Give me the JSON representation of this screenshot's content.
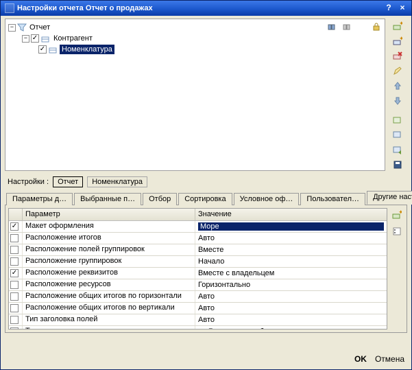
{
  "window": {
    "title": "Настройки отчета  Отчет о продажах"
  },
  "tree": {
    "root": {
      "label": "Отчет",
      "expanded": true
    },
    "child1": {
      "label": "Контрагент",
      "checked": true,
      "expanded": true
    },
    "child2": {
      "label": "Номенклатура",
      "checked": true,
      "selected": true
    }
  },
  "settings": {
    "label": "Настройки :",
    "minitabs": {
      "a": "Отчет",
      "b": "Номенклатура"
    }
  },
  "tabs": {
    "t0": "Параметры д…",
    "t1": "Выбранные п…",
    "t2": "Отбор",
    "t3": "Сортировка",
    "t4": "Условное оф…",
    "t5": "Пользовател…",
    "t6": "Другие настр…"
  },
  "grid": {
    "headers": {
      "param": "Параметр",
      "value": "Значение"
    },
    "rows": [
      {
        "checked": true,
        "param": "Макет оформления",
        "value": "Море",
        "selected": true
      },
      {
        "checked": false,
        "param": "Расположение итогов",
        "value": "Авто"
      },
      {
        "checked": false,
        "param": "Расположение полей группировок",
        "value": "Вместе"
      },
      {
        "checked": false,
        "param": "Расположение группировок",
        "value": "Начало"
      },
      {
        "checked": true,
        "param": "Расположение реквизитов",
        "value": "Вместе с владельцем"
      },
      {
        "checked": false,
        "param": "Расположение ресурсов",
        "value": "Горизонтально"
      },
      {
        "checked": false,
        "param": "Расположение общих итогов по горизонтали",
        "value": "Авто"
      },
      {
        "checked": false,
        "param": "Расположение общих итогов по вертикали",
        "value": "Авто"
      },
      {
        "checked": false,
        "param": "Тип заголовка полей",
        "value": "Авто"
      },
      {
        "checked": false,
        "param": "Тип диаграммы",
        "value": "Гистограмма объемная",
        "icon": "chart"
      }
    ]
  },
  "footer": {
    "ok": "OK",
    "cancel": "Отмена"
  }
}
